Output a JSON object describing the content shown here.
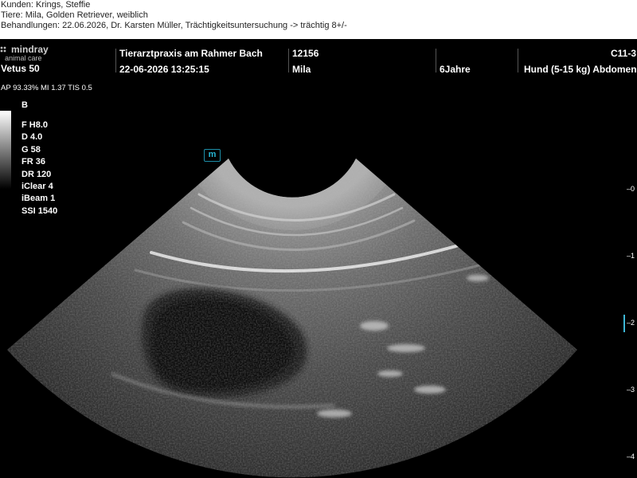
{
  "header_lines": {
    "customer": "Kunden: Krings, Steffie",
    "animal": "Tiere: Mila, Golden Retriever, weiblich",
    "treatment": "Behandlungen: 22.06.2026, Dr. Karsten Müller, Trächtigkeitsuntersuchung -> trächtig 8+/-"
  },
  "device": {
    "brand": "mindray",
    "brand_sub": "animal care",
    "model": "Vetus 50"
  },
  "topbar": {
    "clinic": "Tierarztpraxis am Rahmer Bach",
    "datetime": "22-06-2026  13:25:15",
    "patient_id": "12156",
    "patient_name": "Mila",
    "age": "6Jahre",
    "probe": "C11-3",
    "preset": "Hund (5-15 kg) Abdomen"
  },
  "acoustic": "AP 93.33%  MI 1.37 TIS 0.5",
  "mode": "B",
  "params": [
    "F H8.0",
    "D 4.0",
    "G 58",
    "FR 36",
    "DR 120",
    "iClear 4",
    "iBeam 1",
    "SSI 1540"
  ],
  "badge": "m",
  "depth_ticks": [
    "0",
    "1",
    "2",
    "3",
    "4"
  ],
  "colors": {
    "accent": "#27b6d4",
    "background": "#000000"
  }
}
